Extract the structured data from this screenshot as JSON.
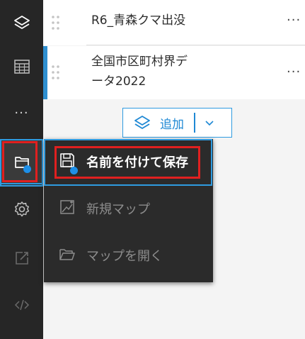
{
  "layers": [
    {
      "name": "R6_青森クマ出没",
      "more": "···"
    },
    {
      "name_line1": "全国市区町村界デ",
      "name_line2": "ータ2022",
      "more": "···"
    }
  ],
  "add_button": {
    "label": "追加"
  },
  "menu": {
    "items": [
      {
        "label": "名前を付けて保存",
        "icon": "save-icon"
      },
      {
        "label": "新規マップ",
        "icon": "new-map-icon"
      },
      {
        "label": "マップを開く",
        "icon": "folder-open-icon"
      }
    ]
  },
  "rail": {
    "more": "···",
    "icons": [
      "layers-icon",
      "table-icon",
      "more-icon",
      "folder-icon",
      "gear-icon",
      "share-icon",
      "code-icon"
    ]
  },
  "colors": {
    "rail_bg": "#262626",
    "menu_bg": "#2b2b2b",
    "accent_blue": "#2f9be0",
    "highlight_red": "#e02020"
  }
}
